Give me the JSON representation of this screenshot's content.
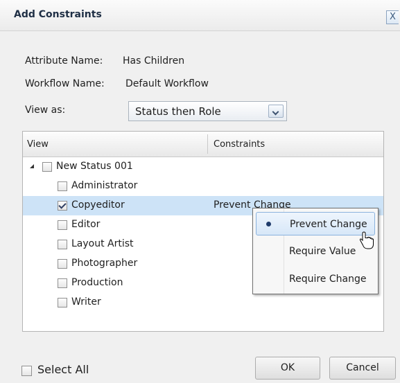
{
  "dialog": {
    "title": "Add Constraints",
    "close_label": "X"
  },
  "fields": {
    "attribute_label": "Attribute Name:",
    "attribute_value": "Has Children",
    "workflow_label": "Workflow Name:",
    "workflow_value": "Default Workflow",
    "view_as_label": "View as:",
    "view_as_value": "Status then Role"
  },
  "grid": {
    "col_view": "View",
    "col_constraints": "Constraints",
    "status": {
      "label": "New Status 001",
      "expanded": true,
      "checked": false
    },
    "roles": [
      {
        "label": "Administrator",
        "checked": false,
        "constraint": ""
      },
      {
        "label": "Copyeditor",
        "checked": true,
        "constraint": "Prevent Change",
        "selected": true
      },
      {
        "label": "Editor",
        "checked": false,
        "constraint": ""
      },
      {
        "label": "Layout Artist",
        "checked": false,
        "constraint": ""
      },
      {
        "label": "Photographer",
        "checked": false,
        "constraint": ""
      },
      {
        "label": "Production",
        "checked": false,
        "constraint": ""
      },
      {
        "label": "Writer",
        "checked": false,
        "constraint": ""
      }
    ]
  },
  "constraint_menu": {
    "items": [
      {
        "label": "Prevent Change",
        "selected": true
      },
      {
        "label": "Require Value",
        "selected": false
      },
      {
        "label": "Require Change",
        "selected": false
      }
    ]
  },
  "footer": {
    "select_all_label": "Select All",
    "ok_label": "OK",
    "cancel_label": "Cancel"
  },
  "colors": {
    "selected_row": "#cde3f7",
    "menu_highlight": "#d7e7f8",
    "title_text": "#1f2f45"
  }
}
